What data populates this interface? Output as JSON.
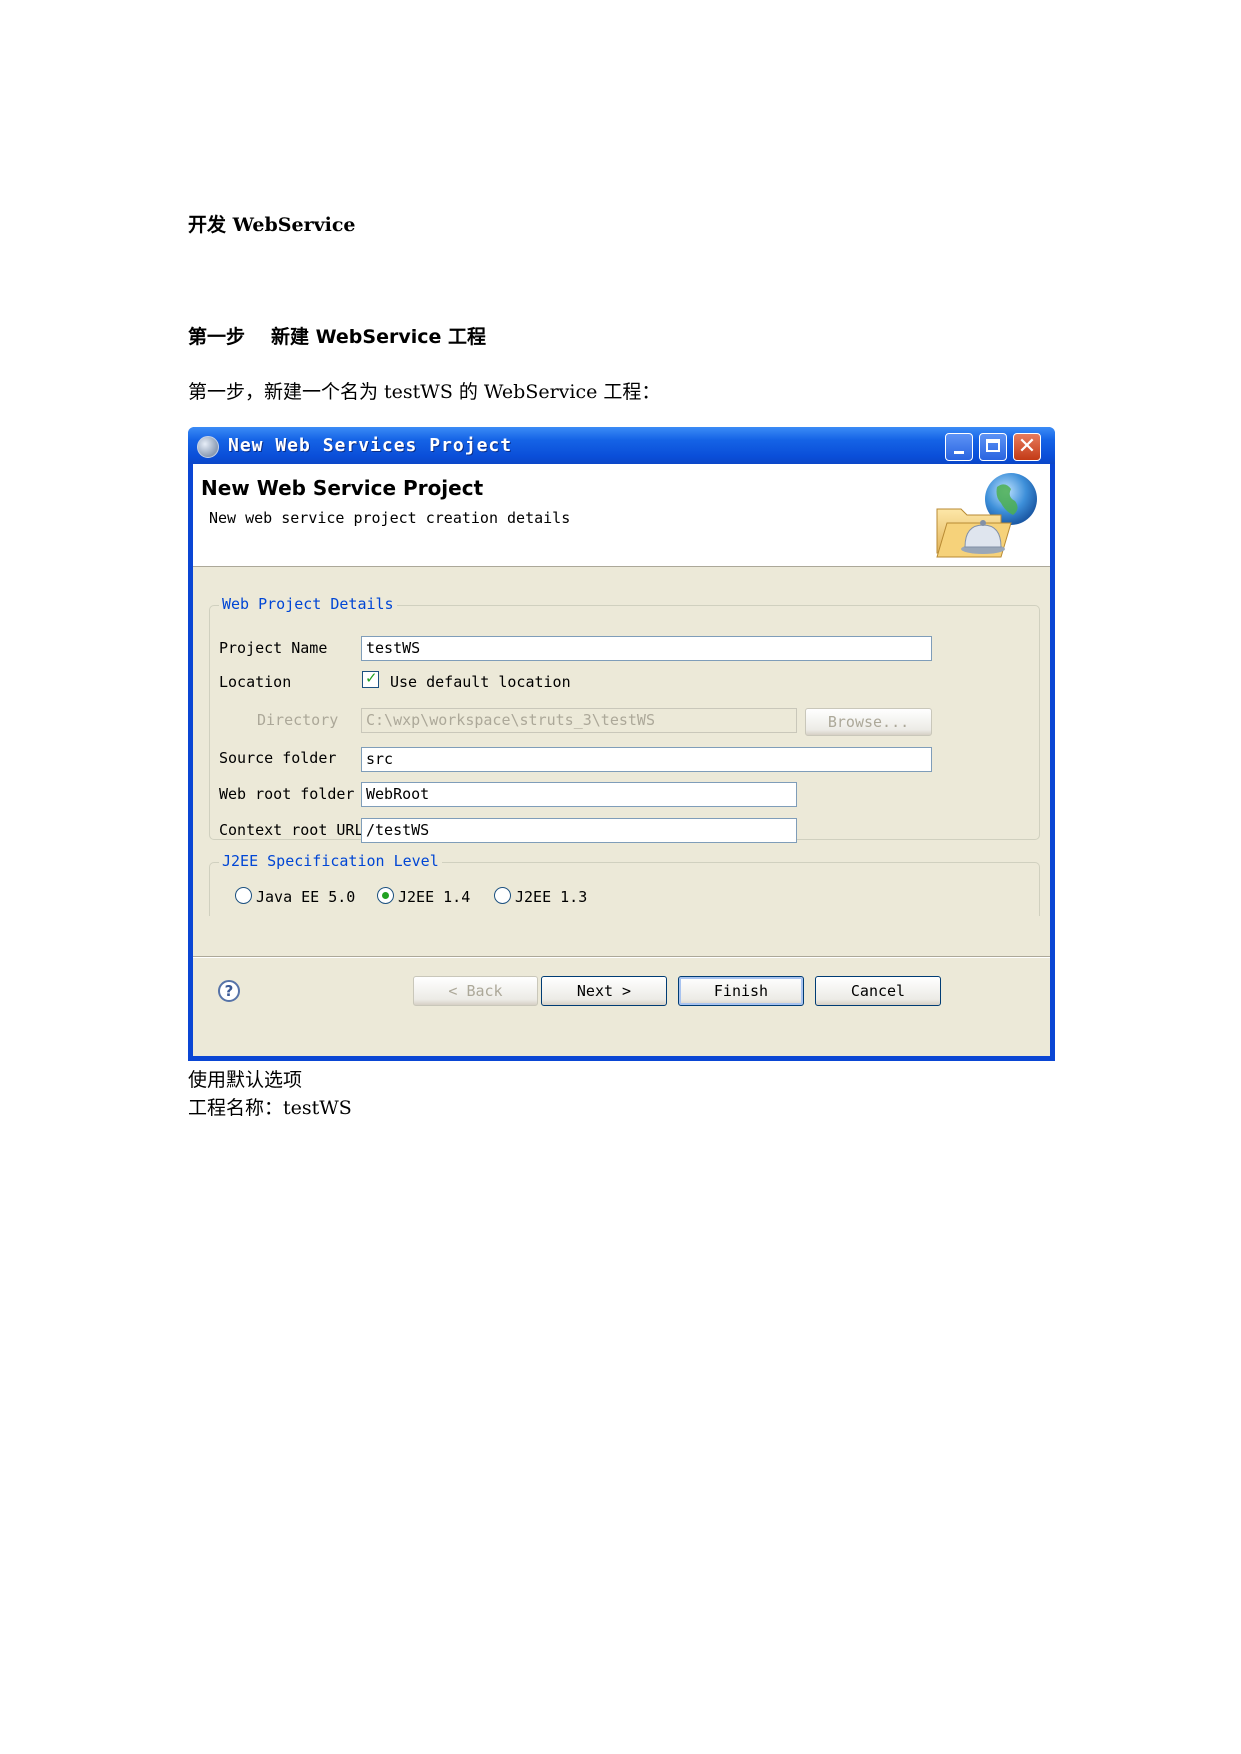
{
  "doc": {
    "title": "开发 WebService",
    "step_label": "第一步",
    "step_title": "新建 WebService 工程",
    "step_text": "第一步，新建一个名为 testWS 的 WebService 工程：",
    "note_default": "使用默认选项",
    "note_name": "工程名称：testWS"
  },
  "dialog": {
    "window_title": "New Web Services Project",
    "header_title": "New Web Service Project",
    "header_subtitle": "New web service project creation details",
    "group1_title": "Web Project Details",
    "project_name_label": "Project Name",
    "project_name_value": "testWS",
    "location_label": "Location",
    "use_default_label": "Use default location",
    "use_default_checked": true,
    "directory_label": "Directory",
    "directory_value": "C:\\wxp\\workspace\\struts_3\\testWS",
    "browse_label": "Browse...",
    "source_folder_label": "Source folder",
    "source_folder_value": "src",
    "web_root_label": "Web root folder",
    "web_root_value": "WebRoot",
    "context_root_label": "Context root URL",
    "context_root_value": "/testWS",
    "group2_title": "J2EE Specification Level",
    "levels": [
      {
        "label": "Java EE 5.0",
        "selected": false
      },
      {
        "label": "J2EE 1.4",
        "selected": true
      },
      {
        "label": "J2EE 1.3",
        "selected": false
      }
    ],
    "buttons": {
      "back": "< Back",
      "next": "Next >",
      "finish": "Finish",
      "cancel": "Cancel"
    },
    "help_glyph": "?",
    "close_glyph": "✕"
  },
  "colors": {
    "titlebar": "#0a46d4",
    "client": "#ece9d8",
    "group_legend": "#0046d5",
    "check_green": "#21a121"
  }
}
